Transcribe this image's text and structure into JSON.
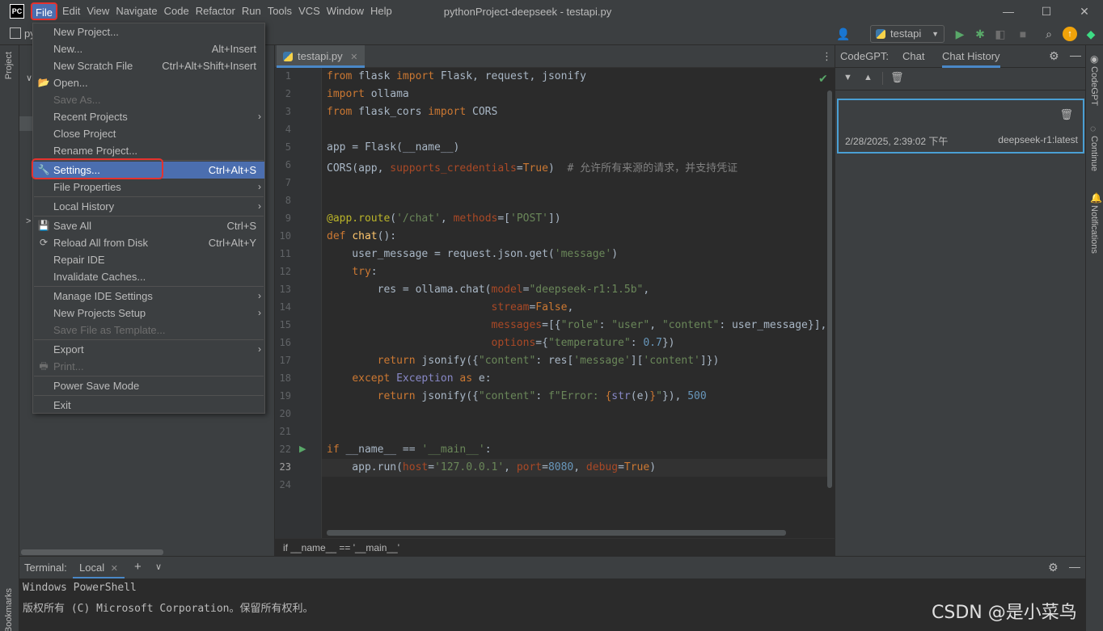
{
  "app": {
    "logo_text": "PC",
    "window_title": "pythonProject-deepseek - testapi.py",
    "window_controls": {
      "minimize": "—",
      "maximize": "☐",
      "close": "✕"
    }
  },
  "menubar": [
    "File",
    "Edit",
    "View",
    "Navigate",
    "Code",
    "Refactor",
    "Run",
    "Tools",
    "VCS",
    "Window",
    "Help"
  ],
  "toolbar": {
    "run_config": "testapi",
    "project_label": "py"
  },
  "file_menu": {
    "items": [
      {
        "label": "New Project...",
        "shortcut": "",
        "disabled": false,
        "submenu": false,
        "icon": ""
      },
      {
        "label": "New...",
        "shortcut": "Alt+Insert",
        "disabled": false,
        "submenu": false,
        "icon": ""
      },
      {
        "label": "New Scratch File",
        "shortcut": "Ctrl+Alt+Shift+Insert",
        "disabled": false,
        "submenu": false,
        "icon": ""
      },
      {
        "label": "Open...",
        "shortcut": "",
        "disabled": false,
        "submenu": false,
        "icon": "folder-icon"
      },
      {
        "label": "Save As...",
        "shortcut": "",
        "disabled": true,
        "submenu": false,
        "icon": ""
      },
      {
        "label": "Recent Projects",
        "shortcut": "",
        "disabled": false,
        "submenu": true,
        "icon": ""
      },
      {
        "label": "Close Project",
        "shortcut": "",
        "disabled": false,
        "submenu": false,
        "icon": ""
      },
      {
        "label": "Rename Project...",
        "shortcut": "",
        "disabled": false,
        "submenu": false,
        "icon": ""
      },
      {
        "label": "Settings...",
        "shortcut": "Ctrl+Alt+S",
        "disabled": false,
        "submenu": false,
        "icon": "wrench-icon",
        "selected": true
      },
      {
        "label": "File Properties",
        "shortcut": "",
        "disabled": false,
        "submenu": true,
        "icon": ""
      },
      {
        "label": "Local History",
        "shortcut": "",
        "disabled": false,
        "submenu": true,
        "icon": ""
      },
      {
        "label": "Save All",
        "shortcut": "Ctrl+S",
        "disabled": false,
        "submenu": false,
        "icon": "save-icon"
      },
      {
        "label": "Reload All from Disk",
        "shortcut": "Ctrl+Alt+Y",
        "disabled": false,
        "submenu": false,
        "icon": "reload-icon"
      },
      {
        "label": "Repair IDE",
        "shortcut": "",
        "disabled": false,
        "submenu": false,
        "icon": ""
      },
      {
        "label": "Invalidate Caches...",
        "shortcut": "",
        "disabled": false,
        "submenu": false,
        "icon": ""
      },
      {
        "label": "Manage IDE Settings",
        "shortcut": "",
        "disabled": false,
        "submenu": true,
        "icon": ""
      },
      {
        "label": "New Projects Setup",
        "shortcut": "",
        "disabled": false,
        "submenu": true,
        "icon": ""
      },
      {
        "label": "Save File as Template...",
        "shortcut": "",
        "disabled": true,
        "submenu": false,
        "icon": ""
      },
      {
        "label": "Export",
        "shortcut": "",
        "disabled": false,
        "submenu": true,
        "icon": ""
      },
      {
        "label": "Print...",
        "shortcut": "",
        "disabled": true,
        "submenu": false,
        "icon": "print-icon"
      },
      {
        "label": "Power Save Mode",
        "shortcut": "",
        "disabled": false,
        "submenu": false,
        "icon": ""
      },
      {
        "label": "Exit",
        "shortcut": "",
        "disabled": false,
        "submenu": false,
        "icon": ""
      }
    ]
  },
  "editor": {
    "tab": "testapi.py",
    "breadcrumb": "if __name__ == '__main__'",
    "current_line": 23,
    "line_count": 24
  },
  "side_strips": {
    "left": [
      "Project",
      "Bookmarks"
    ],
    "right": [
      "CodeGPT",
      "Continue",
      "Notifications"
    ]
  },
  "codegpt": {
    "title": "CodeGPT:",
    "tabs": [
      "Chat",
      "Chat History"
    ],
    "active_tab": "Chat History",
    "history": [
      {
        "date": "2/28/2025, 2:39:02 下午",
        "model": "deepseek-r1:latest"
      }
    ]
  },
  "terminal": {
    "label": "Terminal:",
    "tab": "Local",
    "lines": [
      "Windows PowerShell",
      "版权所有 (C) Microsoft Corporation。保留所有权利。"
    ]
  },
  "watermark": "CSDN @是小菜鸟"
}
